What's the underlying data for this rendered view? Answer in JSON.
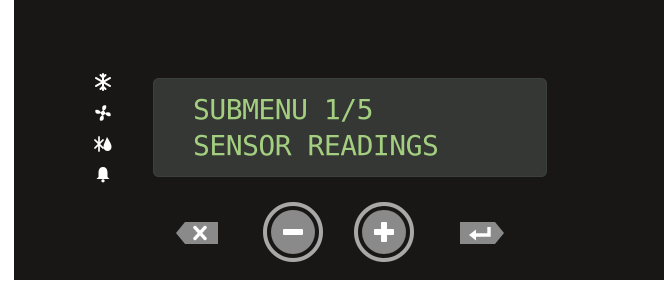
{
  "status_icons": [
    {
      "name": "snowflake-icon",
      "meaning": "cooling"
    },
    {
      "name": "fan-icon",
      "meaning": "fan"
    },
    {
      "name": "defrost-icon",
      "meaning": "defrost"
    },
    {
      "name": "bell-icon",
      "meaning": "alarm"
    }
  ],
  "display": {
    "line1": "SUBMENU 1/5",
    "line2": "SENSOR READINGS"
  },
  "buttons": {
    "cancel": {
      "icon": "cancel-icon"
    },
    "minus": {
      "icon": "minus-icon"
    },
    "plus": {
      "icon": "plus-icon"
    },
    "enter": {
      "icon": "enter-icon"
    }
  },
  "colors": {
    "panel": "#181716",
    "lcd_background": "#343734",
    "lcd_text": "#a4cf80",
    "icon": "#ffffff",
    "button_ring": "#a8a8a8",
    "button_fill": "#8a8a8a"
  }
}
